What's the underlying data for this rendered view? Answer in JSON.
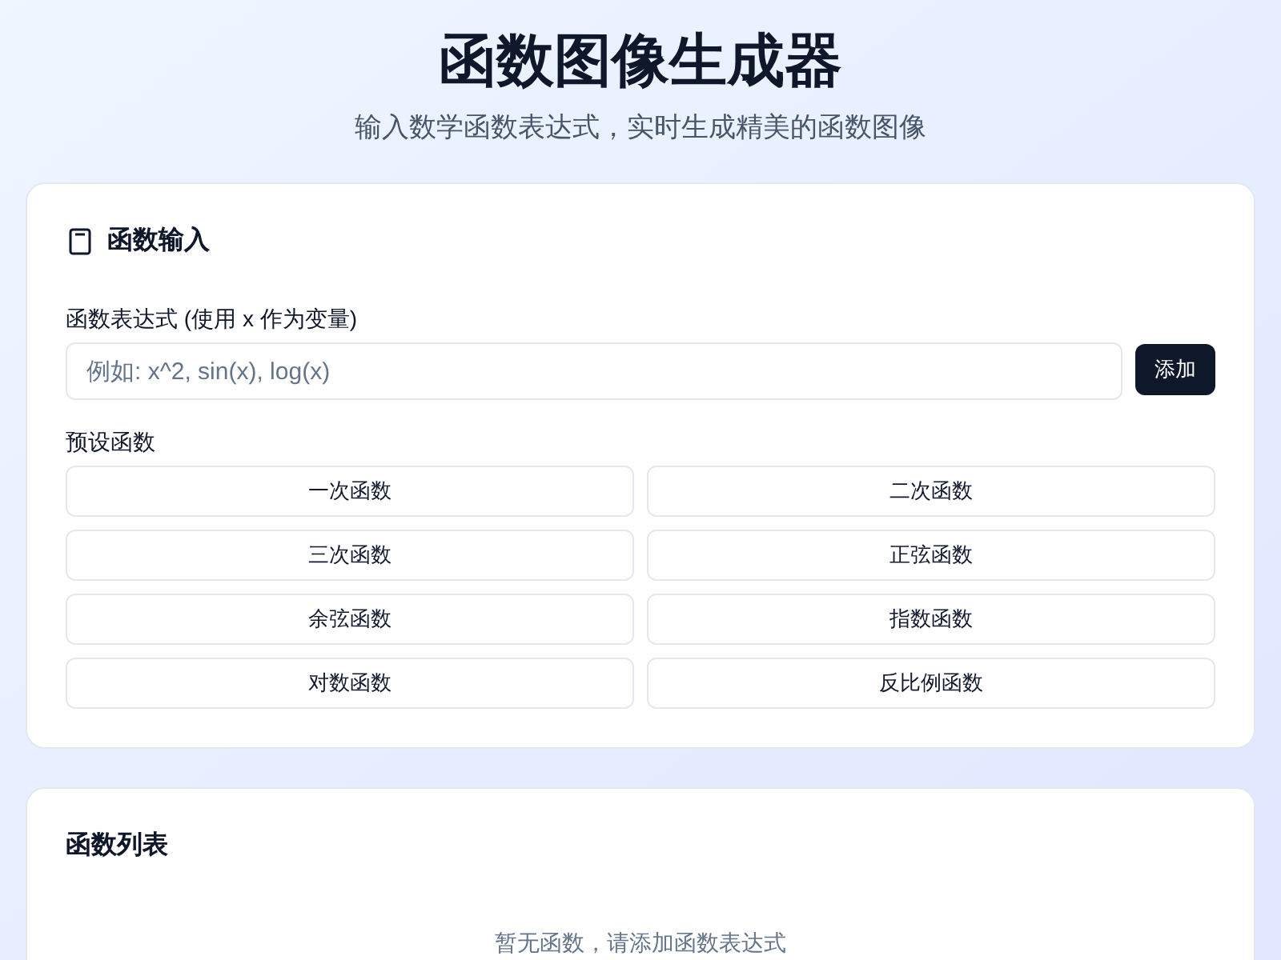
{
  "header": {
    "title": "函数图像生成器",
    "subtitle": "输入数学函数表达式，实时生成精美的函数图像"
  },
  "input_card": {
    "title": "函数输入",
    "field_label": "函数表达式 (使用 x 作为变量)",
    "placeholder": "例如: x^2, sin(x), log(x)",
    "add_button": "添加",
    "presets_label": "预设函数",
    "presets": [
      "一次函数",
      "二次函数",
      "三次函数",
      "正弦函数",
      "余弦函数",
      "指数函数",
      "对数函数",
      "反比例函数"
    ]
  },
  "list_card": {
    "title": "函数列表",
    "empty_message": "暂无函数，请添加函数表达式"
  }
}
